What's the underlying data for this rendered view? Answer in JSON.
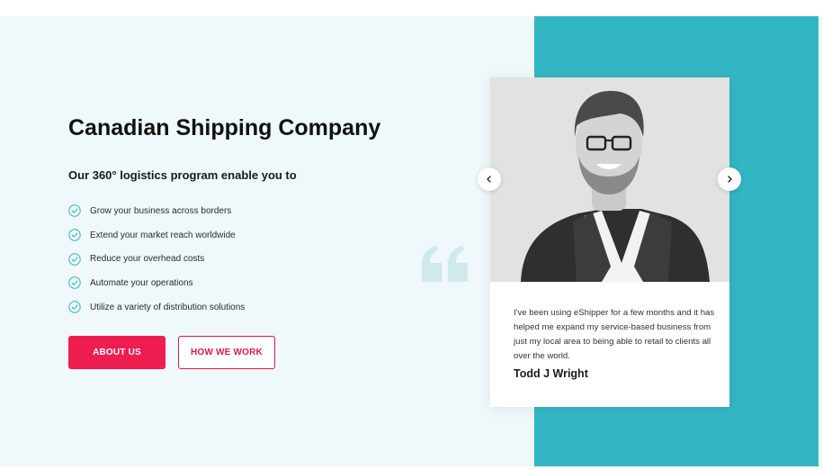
{
  "hero": {
    "title": "Canadian Shipping Company",
    "subtitle": "Our 360° logistics program enable you to",
    "benefits": [
      "Grow your business across borders",
      "Extend your market reach worldwide",
      "Reduce your overhead costs",
      "Automate your operations",
      "Utilize a variety of distribution solutions"
    ],
    "buttons": {
      "about": "ABOUT US",
      "how": "HOW WE WORK"
    }
  },
  "testimonial": {
    "quote": "I've been using eShipper for a few months and it has helped me expand my service-based business from just my local area to being able to retail to clients all over the world.",
    "author": "Todd J Wright"
  },
  "icons": {
    "check": "check-circle-icon",
    "quote": "quote-mark-icon",
    "prev": "chevron-left-icon",
    "next": "chevron-right-icon"
  },
  "colors": {
    "accent": "#ee1d4f",
    "teal": "#33b6c3",
    "background": "#eff8fa",
    "check": "#33b6c3"
  }
}
